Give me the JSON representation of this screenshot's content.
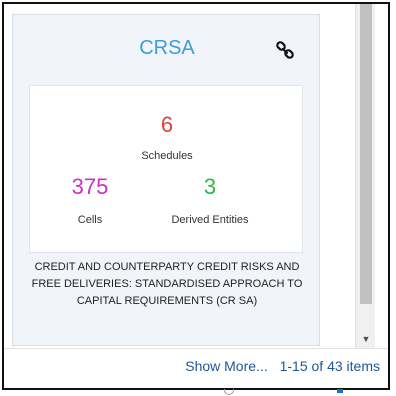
{
  "card": {
    "title": "CRSA",
    "link_icon": "link-icon",
    "schedules": {
      "value": "6",
      "label": "Schedules",
      "color": "#e0413b"
    },
    "cells": {
      "value": "375",
      "label": "Cells",
      "color": "#c633c6"
    },
    "derived": {
      "value": "3",
      "label": "Derived Entities",
      "color": "#2bb84a"
    },
    "description": "CREDIT AND COUNTERPARTY CREDIT RISKS AND FREE DELIVERIES: STANDARDISED APPROACH TO CAPITAL REQUIREMENTS (CR SA)"
  },
  "scrollbar": {
    "down_arrow": "▼"
  },
  "footer": {
    "show_more": "Show More...",
    "pagination": "1-15 of 43 items"
  },
  "colors": {
    "title": "#3a9fd6",
    "link_text": "#1e5799"
  }
}
